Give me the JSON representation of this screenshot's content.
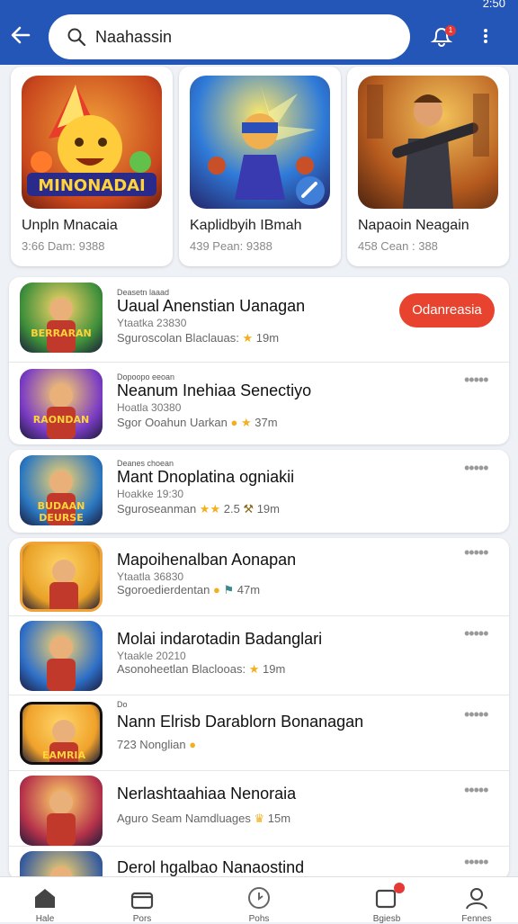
{
  "status_bar": {
    "time": "2:50"
  },
  "search": {
    "query": "Naahassin"
  },
  "notifications": {
    "badge": "1"
  },
  "featured": [
    {
      "logo_text": "MINONADAI",
      "title": "Unpln Mnacaia",
      "meta": "3:66 Dam: 9388"
    },
    {
      "logo_text": "",
      "title": "Kaplidbyih IBmah",
      "meta": "439 Pean: 9388"
    },
    {
      "logo_text": "",
      "title": "Napaoin Neagain",
      "meta": "458 Cean : 388"
    }
  ],
  "list": [
    {
      "publisher": "Deasetn laaad",
      "name": "Uaual Anenstian Uanagan",
      "sub": "Ytaatka 23830",
      "info": "Sguroscolan Blaclauas:",
      "rating": "19m",
      "action": "Odanreasia",
      "logo_text": "BERRARAN",
      "bg": "#3e8f3a"
    },
    {
      "publisher": "Dopoopo eeoan",
      "name": "Neanum Inehiaa Senectiyo",
      "sub": "Hoatla 30380",
      "info": "Sgor Ooahun Uarkan",
      "rating": "37m",
      "action": "",
      "logo_text": "RAONDAN",
      "bg": "#7b3cc4"
    },
    {
      "publisher": "Deanes choean",
      "name": "Mant Dnoplatina ogniakii",
      "sub": "Hoakke 19:30",
      "info": "Sguroseanman",
      "rating": "19m",
      "action": "",
      "logo_text": "BUDAAN DEURSE",
      "bg": "#2a78c2"
    },
    {
      "publisher": "",
      "name": "Mapoihenalban Aonapan",
      "sub": "Ytaatla 36830",
      "info": "Sgoroedierdentan",
      "rating": "47m",
      "action": "",
      "logo_text": "",
      "bg": "#e9a126"
    },
    {
      "publisher": "",
      "name": "Molai indarotadin Badanglari",
      "sub": "Ytaakle 20210",
      "info": "Asonoheetlan Blaclooas:",
      "rating": "19m",
      "action": "",
      "logo_text": "",
      "bg": "#2e6fc8"
    },
    {
      "publisher": "Do",
      "name": "Nann Elrisb Darablorn Bonanagan",
      "sub": "",
      "info": "723 Nonglian",
      "rating": "",
      "action": "",
      "logo_text": "EAMRIA RAMIKHIK",
      "bg": "#f0a22a"
    },
    {
      "publisher": "",
      "name": "Nerlashtaahiaa Nenoraia",
      "sub": "",
      "info": "Aguro Seam Namdluages",
      "rating": "15m",
      "action": "",
      "logo_text": "",
      "bg": "#b6324a"
    },
    {
      "publisher": "",
      "name": "Derol hgalbao Nanaostind",
      "sub": "",
      "info": "",
      "rating": "",
      "action": "",
      "logo_text": "",
      "bg": "#3a5f9e"
    }
  ],
  "bottom_nav": [
    {
      "label": "Hale"
    },
    {
      "label": "Pors"
    },
    {
      "label": "Pohs"
    },
    {
      "label": "Bgiesb"
    },
    {
      "label": "Fennes"
    }
  ],
  "colors": {
    "header": "#2456b8",
    "accent": "#e8432e"
  }
}
